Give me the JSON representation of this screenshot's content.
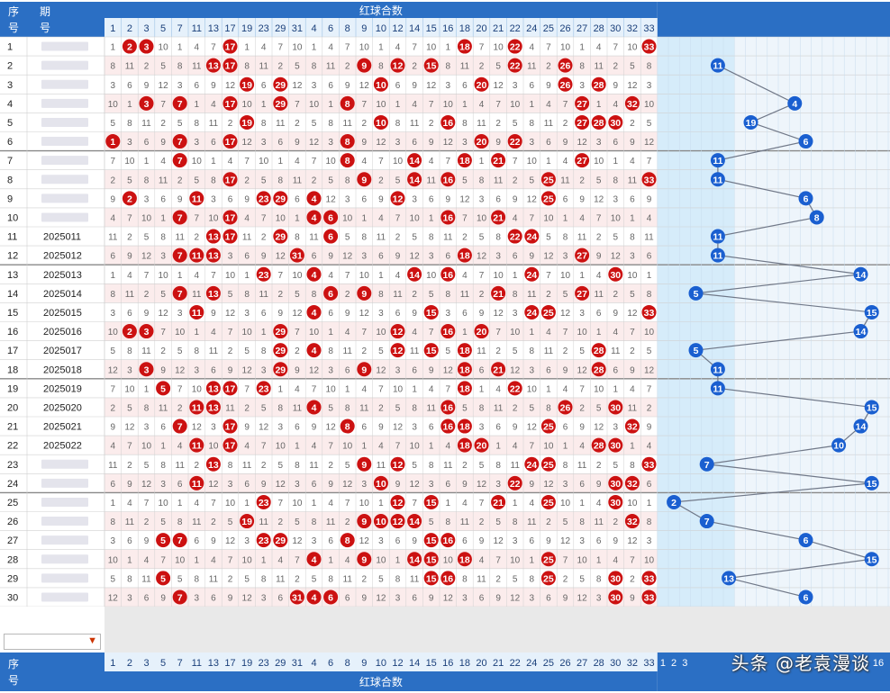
{
  "header": {
    "col_seq": "序号",
    "col_period": "期号",
    "red_group_title": "红球合数",
    "footer_seq": "序号",
    "footer_red_group_title": "红球合数"
  },
  "colors": {
    "header_bg": "#2b6fc4",
    "header_light": "#e6f1fb",
    "red_ball": "#cc1111",
    "blue_ball": "#1a5fd0",
    "row_pink": "#fbecec",
    "blue_zone": "#d6ecfa",
    "grid_line": "#d0d0d0",
    "number_text": "#666666"
  },
  "watermark": "头条 @老袁漫谈",
  "chart_data": {
    "type": "table",
    "red_columns": [
      "1",
      "2",
      "3",
      "5",
      "7",
      "11",
      "13",
      "17",
      "19",
      "23",
      "29",
      "31",
      "4",
      "6",
      "8",
      "9",
      "10",
      "12",
      "14",
      "15",
      "16",
      "18",
      "20",
      "21",
      "22",
      "24",
      "25",
      "26",
      "27",
      "28",
      "30",
      "32",
      "33"
    ],
    "blue_columns": [
      "1",
      "2",
      "3",
      "5",
      "7",
      "11",
      "13",
      "17",
      "19",
      "23",
      "29",
      "31",
      "4",
      "6",
      "8",
      "9",
      "10",
      "12",
      "14",
      "15",
      "16"
    ],
    "blue_columns_visible_footer": [
      "1",
      "2",
      "3",
      "16"
    ],
    "periods": [
      "",
      "",
      "",
      "",
      "",
      "",
      "",
      "",
      "",
      "",
      "2025011",
      "2025012",
      "2025013",
      "2025014",
      "2025015",
      "2025016",
      "2025017",
      "2025018",
      "2025019",
      "2025020",
      "2025021",
      "2025022",
      "",
      "",
      "",
      "",
      "",
      "",
      "",
      ""
    ],
    "seq_labels": [
      "1",
      "2",
      "3",
      "4",
      "5",
      "6",
      "7",
      "8",
      "9",
      "10",
      "11",
      "12",
      "13",
      "14",
      "15",
      "16",
      "17",
      "18",
      "19",
      "20",
      "21",
      "22",
      "23",
      "24",
      "25",
      "26",
      "27",
      "28",
      "29",
      "30"
    ],
    "red_hits": [
      [
        2,
        3,
        17,
        18,
        22,
        33
      ],
      [
        13,
        17,
        9,
        12,
        15,
        22,
        26
      ],
      [
        19,
        29,
        10,
        20,
        26,
        28
      ],
      [
        3,
        7,
        8,
        17,
        29,
        27,
        32
      ],
      [
        19,
        10,
        16,
        27,
        28,
        30
      ],
      [
        1,
        7,
        17,
        8,
        20,
        22
      ],
      [
        7,
        8,
        14,
        18,
        21,
        27
      ],
      [
        17,
        9,
        14,
        16,
        25,
        33
      ],
      [
        2,
        11,
        23,
        29,
        4,
        12,
        25
      ],
      [
        7,
        17,
        4,
        6,
        16,
        21
      ],
      [
        13,
        17,
        29,
        6,
        22,
        24
      ],
      [
        7,
        11,
        13,
        31,
        18,
        27
      ],
      [
        23,
        4,
        14,
        16,
        24,
        30
      ],
      [
        7,
        13,
        6,
        9,
        21,
        27
      ],
      [
        11,
        4,
        15,
        24,
        25,
        33
      ],
      [
        2,
        3,
        29,
        12,
        16,
        20
      ],
      [
        29,
        4,
        12,
        15,
        18,
        28
      ],
      [
        3,
        29,
        9,
        18,
        21,
        28
      ],
      [
        5,
        13,
        17,
        23,
        18,
        22
      ],
      [
        11,
        13,
        4,
        16,
        26,
        30
      ],
      [
        7,
        17,
        8,
        16,
        18,
        25,
        32
      ],
      [
        11,
        17,
        18,
        20,
        28,
        30
      ],
      [
        13,
        9,
        12,
        24,
        25,
        33
      ],
      [
        11,
        10,
        22,
        30,
        32
      ],
      [
        23,
        12,
        15,
        21,
        25,
        30
      ],
      [
        19,
        9,
        10,
        12,
        14,
        32
      ],
      [
        5,
        7,
        23,
        29,
        8,
        15,
        16
      ],
      [
        4,
        9,
        14,
        15,
        18,
        25
      ],
      [
        5,
        15,
        16,
        25,
        30,
        33
      ],
      [
        7,
        31,
        4,
        6,
        30,
        33
      ]
    ],
    "blue_hits": [
      null,
      11,
      null,
      4,
      19,
      6,
      11,
      11,
      6,
      8,
      11,
      11,
      14,
      5,
      15,
      14,
      5,
      11,
      11,
      15,
      14,
      10,
      7,
      15,
      2,
      7,
      6,
      15,
      13,
      6
    ],
    "blue_hit_values": {
      "4": "4",
      "19": "9",
      "8": "8",
      "10": "10",
      "13": "13"
    },
    "left_seq_override": {
      "9": "9",
      "10": "10"
    }
  }
}
